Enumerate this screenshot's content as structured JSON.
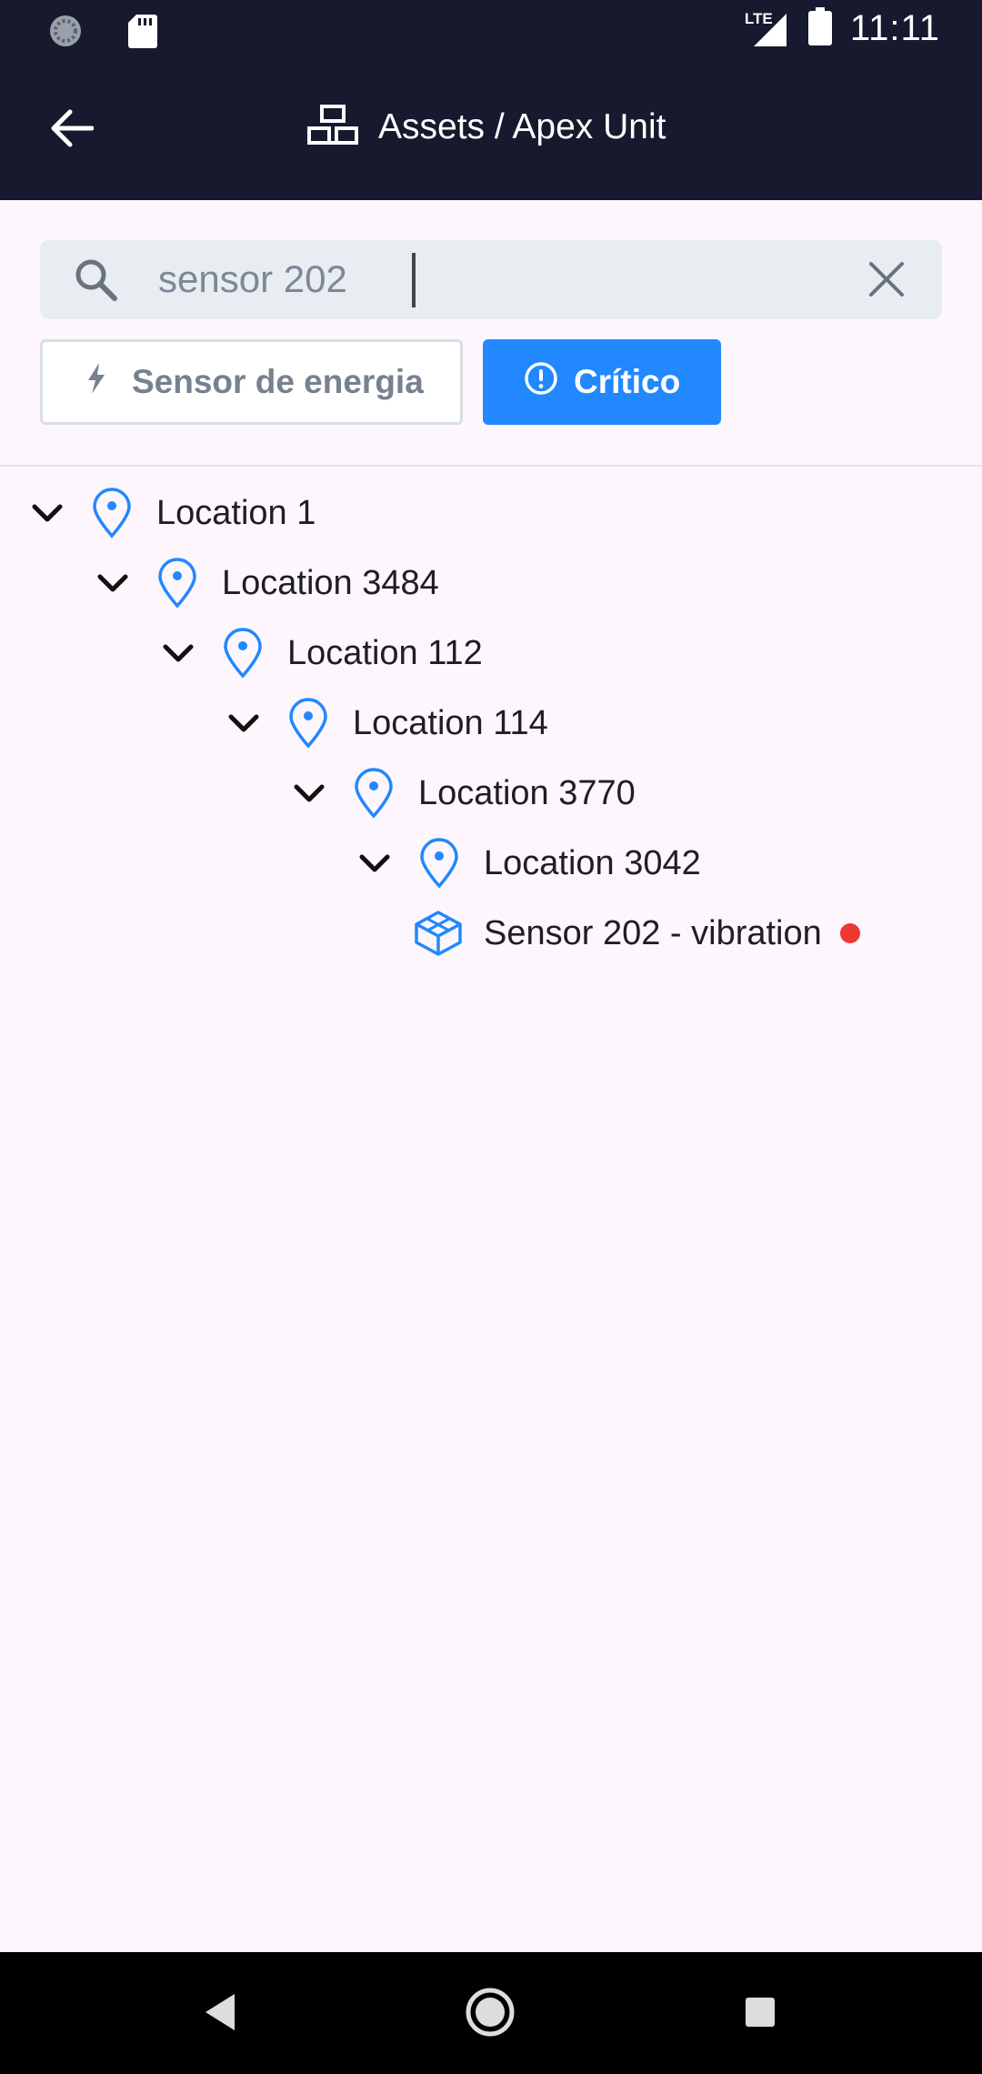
{
  "status_bar": {
    "time": "11:11",
    "network": "LTE",
    "icons": [
      "sync-icon",
      "sd-card-icon",
      "signal-icon",
      "battery-icon"
    ]
  },
  "app_bar": {
    "title": "Assets / Apex Unit",
    "icons": [
      "back-arrow-icon",
      "assets-icon"
    ]
  },
  "search": {
    "value": "sensor 202",
    "icons": [
      "search-icon",
      "clear-icon"
    ]
  },
  "filters": {
    "energy_label": "Sensor de energia",
    "critical_label": "Crítico",
    "critical_active": true,
    "icons": [
      "bolt-icon",
      "alert-circle-icon"
    ]
  },
  "tree": [
    {
      "label": "Location 1",
      "type": "location",
      "depth": 0,
      "expanded": true
    },
    {
      "label": "Location 3484",
      "type": "location",
      "depth": 1,
      "expanded": true
    },
    {
      "label": "Location 112",
      "type": "location",
      "depth": 2,
      "expanded": true
    },
    {
      "label": "Location 114",
      "type": "location",
      "depth": 3,
      "expanded": true
    },
    {
      "label": "Location 3770",
      "type": "location",
      "depth": 4,
      "expanded": true
    },
    {
      "label": "Location 3042",
      "type": "location",
      "depth": 5,
      "expanded": true
    },
    {
      "label": "Sensor 202 - vibration",
      "type": "component",
      "depth": 6,
      "status": "critical"
    }
  ],
  "colors": {
    "header_bg": "#171A2E",
    "accent": "#2188FF",
    "critical_dot": "#ED3833",
    "page_bg": "#FDF6FC"
  },
  "nav_bar": {
    "icons": [
      "nav-back-icon",
      "nav-home-icon",
      "nav-recents-icon"
    ]
  }
}
